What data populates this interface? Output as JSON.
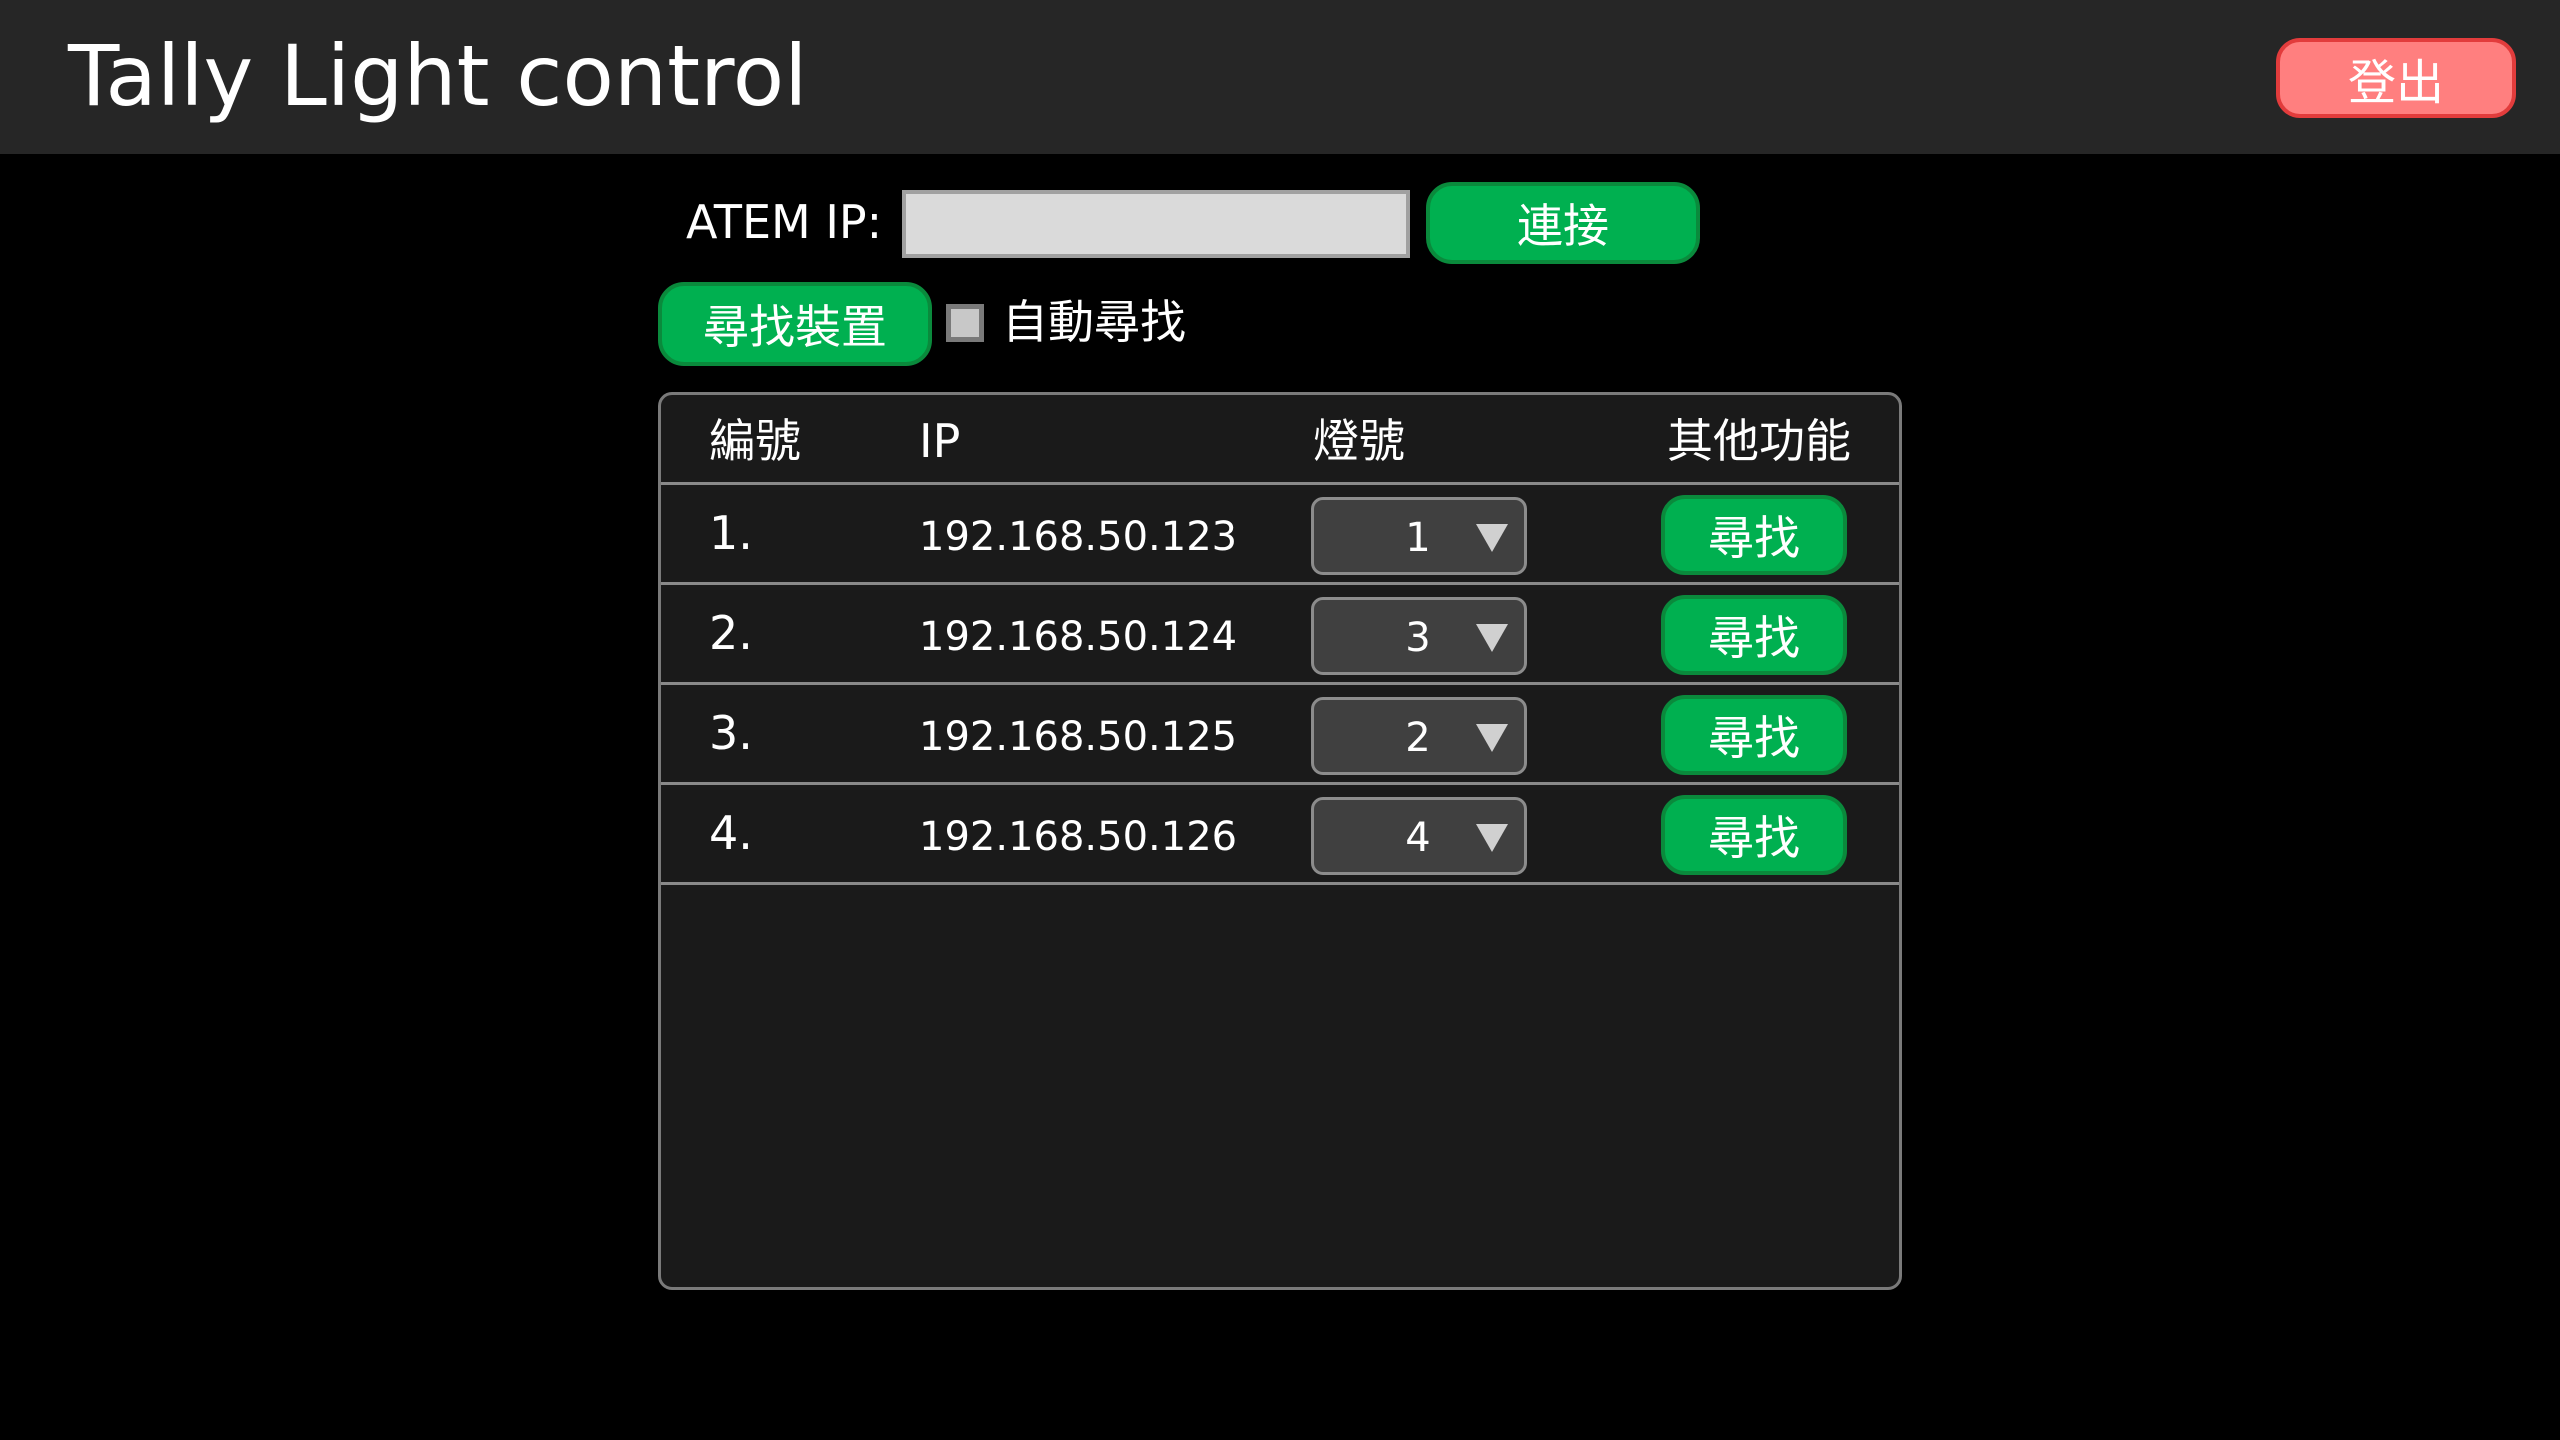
{
  "header": {
    "title": "Tally Light control",
    "logout_label": "登出"
  },
  "connection": {
    "atem_label": "ATEM IP:",
    "atem_ip_value": "",
    "atem_ip_placeholder": "",
    "connect_label": "連接"
  },
  "discovery": {
    "find_devices_label": "尋找裝置",
    "auto_find_label": "自動尋找",
    "auto_find_checked": false
  },
  "table": {
    "columns": [
      "編號",
      "IP",
      "燈號",
      "其他功能"
    ],
    "rows": [
      {
        "num": "1.",
        "ip": "192.168.50.123",
        "light": "1",
        "action": "尋找"
      },
      {
        "num": "2.",
        "ip": "192.168.50.124",
        "light": "3",
        "action": "尋找"
      },
      {
        "num": "3.",
        "ip": "192.168.50.125",
        "light": "2",
        "action": "尋找"
      },
      {
        "num": "4.",
        "ip": "192.168.50.126",
        "light": "4",
        "action": "尋找"
      }
    ]
  },
  "colors": {
    "header_bg": "#262626",
    "page_bg": "#000000",
    "accent_green": "#00b050",
    "logout_red": "#ff7f7f",
    "panel_bg": "#1a1a1a"
  }
}
